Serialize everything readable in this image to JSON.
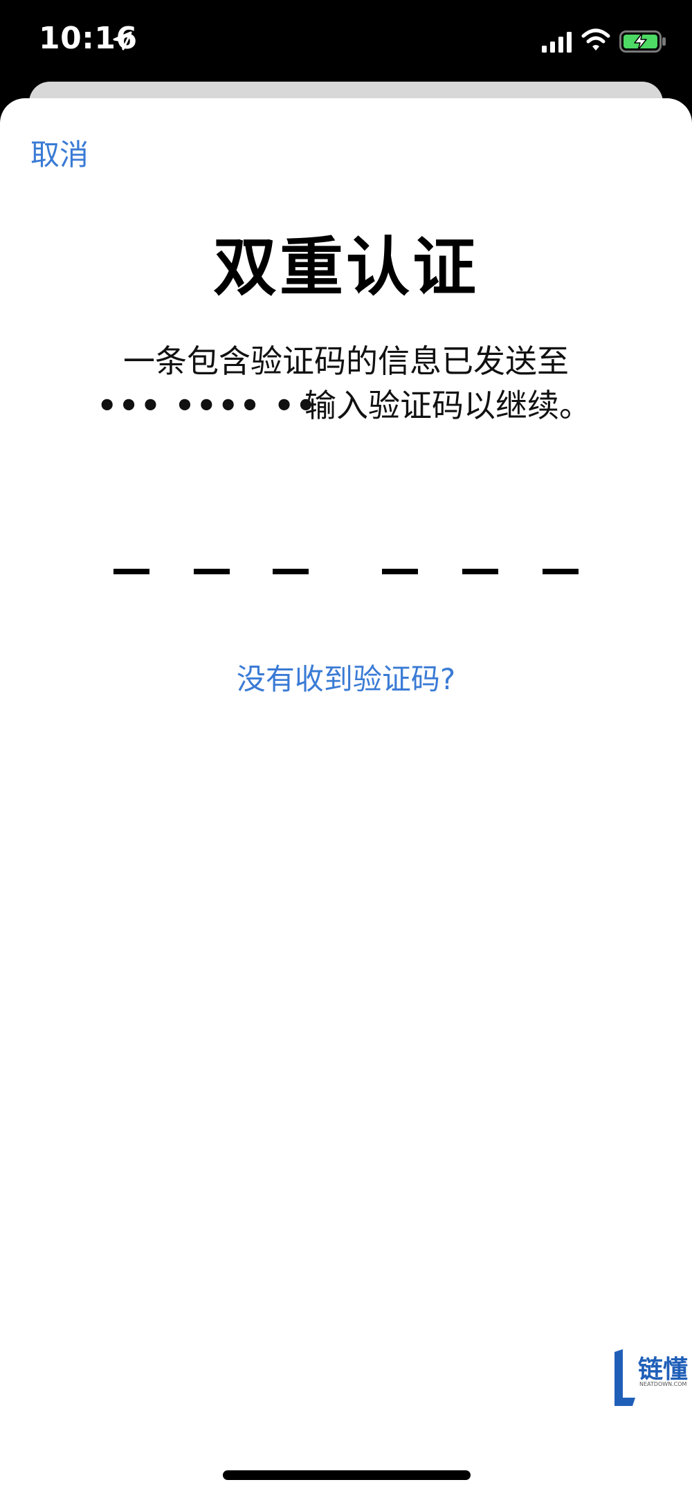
{
  "status_bar": {
    "time": "10:16"
  },
  "header": {
    "cancel_label": "取消"
  },
  "main": {
    "title": "双重认证",
    "description_line1": "一条包含验证码的信息已发送至",
    "masked_phone": "••• •••• ••",
    "description_line2": "输入验证码以继续。",
    "code_slots": 6,
    "code_value": "",
    "resend_label": "没有收到验证码?"
  },
  "watermark": {
    "brand": "链懂",
    "sub": "NEATDOWN.COM"
  },
  "colors": {
    "accent": "#3a7bd5",
    "background": "#ffffff",
    "status_bar": "#000000",
    "battery": "#4cd964"
  },
  "icons": [
    "location-icon",
    "signal-icon",
    "wifi-icon",
    "battery-charging-icon"
  ]
}
